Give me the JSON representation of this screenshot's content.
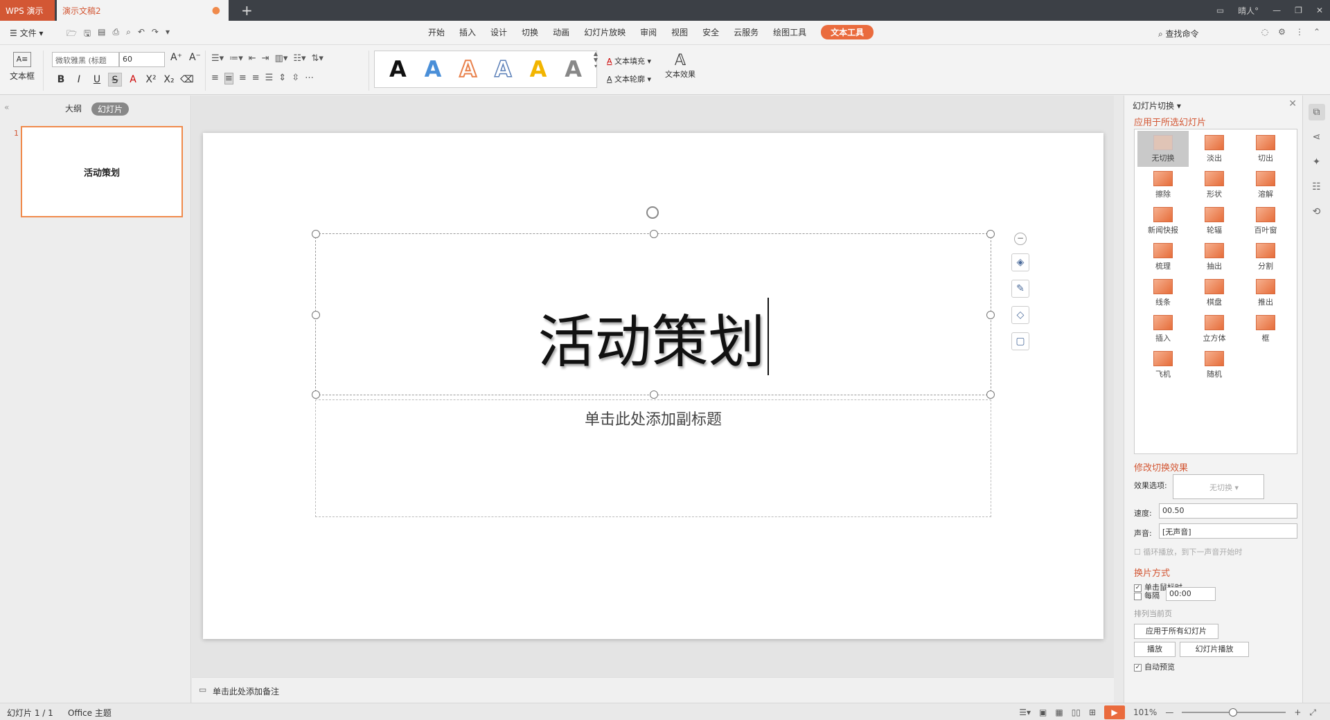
{
  "titlebar": {
    "app_tab": "WPS 演示",
    "doc_tab": "演示文稿2",
    "user": "晴人°",
    "new_tab": "+"
  },
  "menubar": {
    "file": "文件",
    "tabs": [
      "开始",
      "插入",
      "设计",
      "切换",
      "动画",
      "幻灯片放映",
      "审阅",
      "视图",
      "安全",
      "云服务",
      "绘图工具",
      "文本工具"
    ],
    "active_tab": "文本工具",
    "search": "查找命令"
  },
  "ribbon": {
    "textbox_label": "文本框",
    "font_name": "微软雅黑 (标题",
    "font_size": "60",
    "wordart_glyph": "A",
    "text_fill": "文本填充",
    "text_outline": "文本轮廓",
    "text_effect": "文本效果"
  },
  "left_panel": {
    "tab_outline": "大纲",
    "tab_slides": "幻灯片",
    "slide_number": "1",
    "slide_title": "活动策划"
  },
  "slide": {
    "title": "活动策划",
    "subtitle_placeholder": "单击此处添加副标题"
  },
  "notes": {
    "placeholder": "单击此处添加备注"
  },
  "right_panel": {
    "title": "幻灯片切换",
    "apply_to": "应用于所选幻灯片",
    "transitions": [
      "无切换",
      "淡出",
      "切出",
      "擦除",
      "形状",
      "溶解",
      "新闻快报",
      "轮辐",
      "百叶窗",
      "梳理",
      "抽出",
      "分割",
      "线条",
      "棋盘",
      "推出",
      "插入",
      "立方体",
      "框",
      "飞机",
      "随机"
    ],
    "selected_transition": "无切换",
    "modify": "修改切换效果",
    "effect_label": "效果选项:",
    "effect_value": "无切换",
    "speed_label": "速度:",
    "speed_value": "00.50",
    "sound_label": "声音:",
    "sound_value": "[无声音]",
    "loop_label": "循环播放，到下一声音开始时",
    "advance": "换片方式",
    "on_click": "单击鼠标时",
    "every": "每隔",
    "every_value": "00:00",
    "sort": "排列当前页",
    "apply_all": "应用于所有幻灯片",
    "play": "播放",
    "slideshow": "幻灯片播放",
    "auto_preview": "自动预览"
  },
  "status": {
    "slide_count": "幻灯片 1 / 1",
    "theme": "Office 主题",
    "zoom": "101%"
  },
  "colors": {
    "accent": "#ea6b3d",
    "title_bar": "#3c4046"
  }
}
